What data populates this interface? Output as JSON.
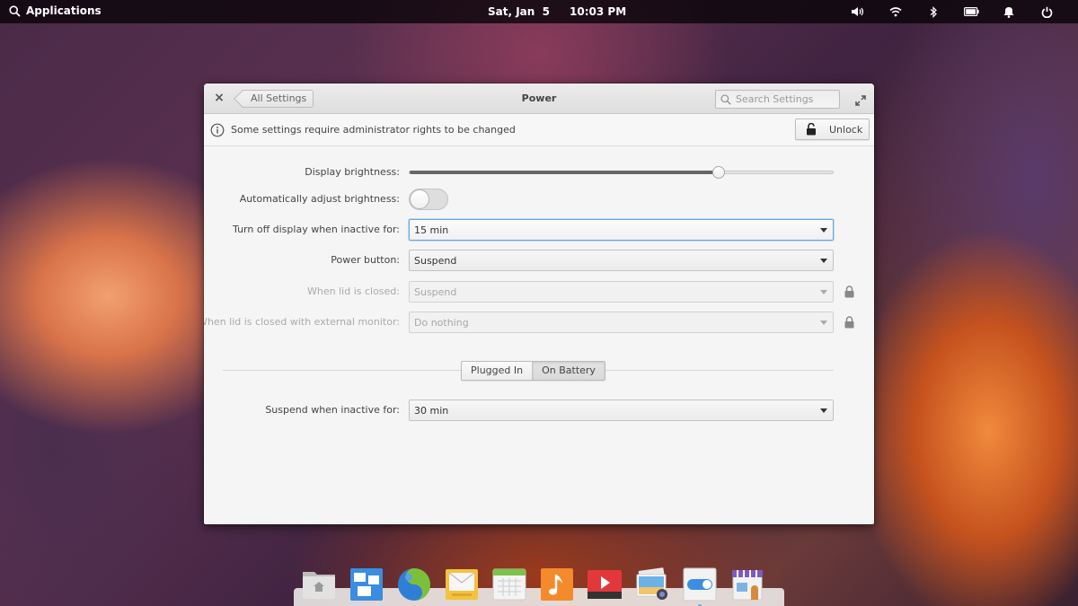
{
  "panel": {
    "applications_label": "Applications",
    "date": "Sat, Jan  5",
    "time": "10:03 PM",
    "indicators": [
      "volume-icon",
      "wifi-icon",
      "bluetooth-icon",
      "battery-icon",
      "notifications-icon",
      "power-icon"
    ]
  },
  "window": {
    "title": "Power",
    "back_label": "All Settings",
    "search_placeholder": "Search Settings",
    "infobar": {
      "message": "Some settings require administrator rights to be changed",
      "unlock_label": "Unlock"
    },
    "settings": {
      "display_brightness": {
        "label": "Display brightness:",
        "value_percent": 73
      },
      "auto_brightness": {
        "label": "Automatically adjust brightness:",
        "enabled": false
      },
      "turn_off_display": {
        "label": "Turn off display when inactive for:",
        "value": "15 min"
      },
      "power_button": {
        "label": "Power button:",
        "value": "Suspend"
      },
      "lid_closed": {
        "label": "When lid is closed:",
        "value": "Suspend",
        "locked": true
      },
      "lid_closed_external": {
        "label": "When lid is closed with external monitor:",
        "value": "Do nothing",
        "locked": true
      }
    },
    "power_source_tabs": [
      {
        "label": "Plugged In",
        "active": false
      },
      {
        "label": "On Battery",
        "active": true
      }
    ],
    "suspend_inactive": {
      "label": "Suspend when inactive for:",
      "value": "30 min"
    }
  },
  "dock": {
    "items": [
      {
        "name": "files",
        "icon": "folder-home-icon"
      },
      {
        "name": "multitasking-view",
        "icon": "multitasking-icon"
      },
      {
        "name": "web-browser",
        "icon": "browser-globe-icon"
      },
      {
        "name": "mail",
        "icon": "mail-icon"
      },
      {
        "name": "calendar",
        "icon": "calendar-icon"
      },
      {
        "name": "music",
        "icon": "music-note-icon"
      },
      {
        "name": "videos",
        "icon": "video-play-icon"
      },
      {
        "name": "photos",
        "icon": "photos-icon"
      },
      {
        "name": "system-settings",
        "icon": "settings-toggle-icon",
        "running": true
      },
      {
        "name": "appcenter",
        "icon": "store-icon"
      }
    ]
  },
  "colors": {
    "focus_accent": "#64a8e2",
    "panel_bg": "#0a050a"
  }
}
